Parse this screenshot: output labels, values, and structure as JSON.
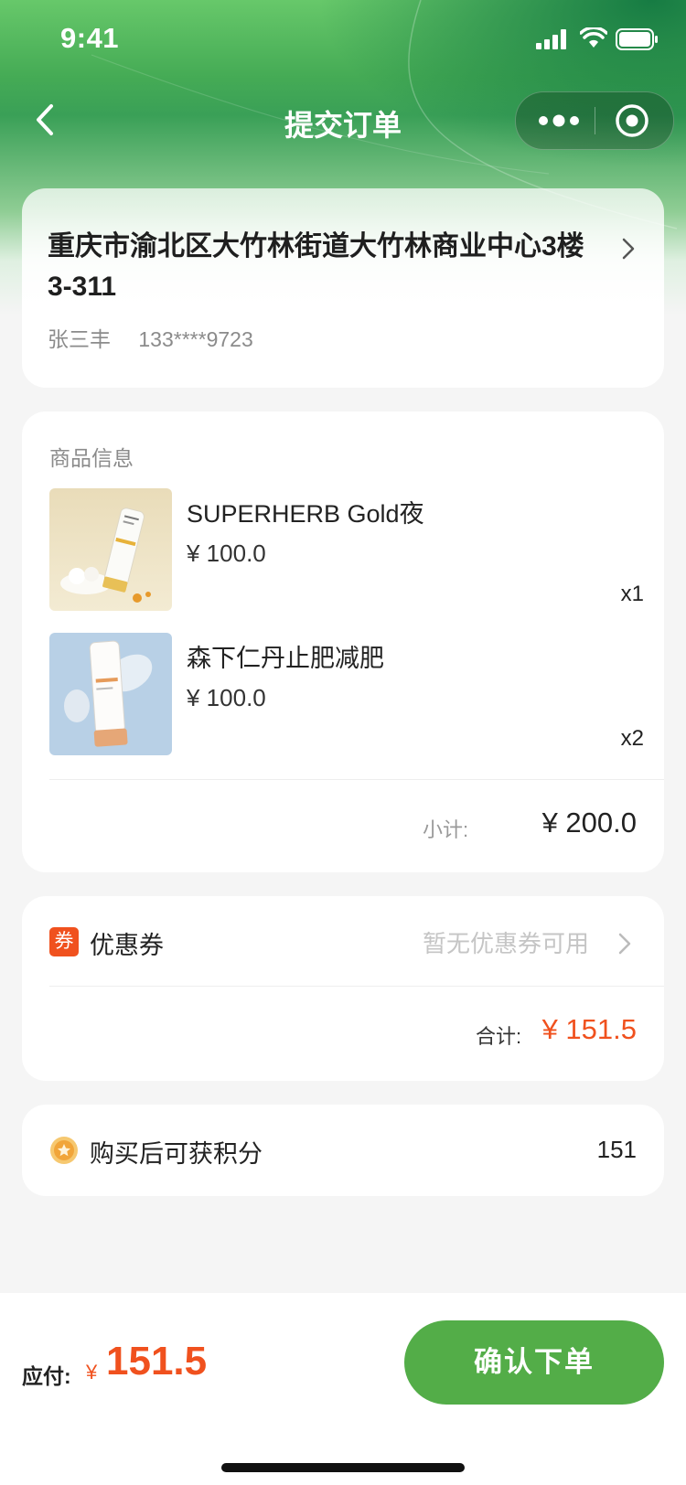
{
  "status_bar": {
    "time": "9:41"
  },
  "nav": {
    "title": "提交订单"
  },
  "address": {
    "line": "重庆市渝北区大竹林街道大竹林商业中心3楼3-311",
    "name": "张三丰",
    "phone": "133****9723"
  },
  "goods": {
    "section_label": "商品信息",
    "items": [
      {
        "name": "SUPERHERB Gold夜",
        "price": "¥ 100.0",
        "qty": "x1"
      },
      {
        "name": "森下仁丹止肥减肥",
        "price": "¥ 100.0",
        "qty": "x2"
      }
    ],
    "subtotal_label": "小计:",
    "subtotal_value": "¥ 200.0"
  },
  "coupon": {
    "badge": "券",
    "label": "优惠券",
    "status": "暂无优惠券可用",
    "total_label": "合计:",
    "total_value": "¥ 151.5"
  },
  "points": {
    "label": "购买后可获积分",
    "value": "151"
  },
  "footer": {
    "pay_label": "应付:",
    "currency": "¥",
    "pay_value": "151.5",
    "confirm_label": "确认下单"
  },
  "colors": {
    "accent_green": "#53ad48",
    "price_orange": "#f0511e",
    "header_green": "#3aa057"
  },
  "icons": [
    "back-arrow-icon",
    "more-dots-icon",
    "close-circle-icon",
    "chevron-right-icon",
    "coupon-icon",
    "coin-icon"
  ]
}
